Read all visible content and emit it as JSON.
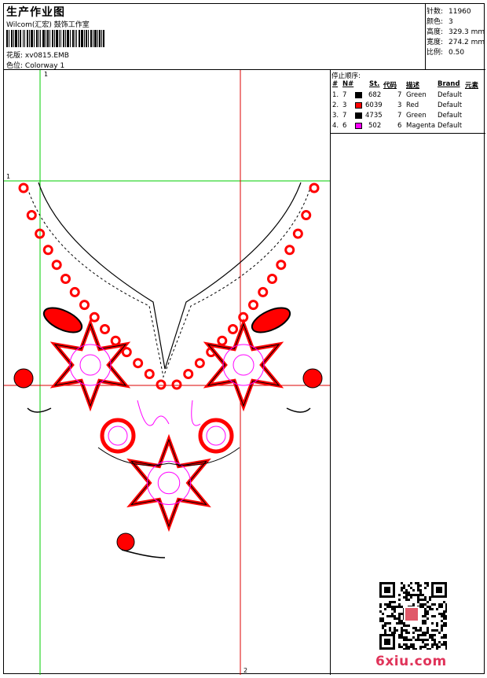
{
  "header": {
    "title": "生产作业图",
    "company": "Wilcom(汇宏) 鼓饰工作室",
    "design_label": "花版:",
    "design_value": "xv0815.EMB",
    "colorway_label": "色位:",
    "colorway_value": "Colorway 1"
  },
  "info": {
    "stitches_label": "针数:",
    "stitches": "11960",
    "colors_label": "颜色:",
    "colors": "3",
    "height_label": "高度:",
    "height": "329.3 mm",
    "width_label": "宽度:",
    "width": "274.2 mm",
    "scale_label": "比例:",
    "scale": "0.50"
  },
  "stop_sequence": {
    "title": "停止顺序:",
    "headers": [
      "#",
      "N#",
      "St.",
      "代码",
      "描述",
      "Brand",
      "元素"
    ],
    "rows": [
      {
        "idx": "1.",
        "n": "7",
        "color": "#000000",
        "st": "682",
        "code": "7",
        "desc": "Green",
        "brand": "Default"
      },
      {
        "idx": "2.",
        "n": "3",
        "color": "#ff0000",
        "st": "6039",
        "code": "3",
        "desc": "Red",
        "brand": "Default"
      },
      {
        "idx": "3.",
        "n": "7",
        "color": "#000000",
        "st": "4735",
        "code": "7",
        "desc": "Green",
        "brand": "Default"
      },
      {
        "idx": "4.",
        "n": "6",
        "color": "#ff00ff",
        "st": "502",
        "code": "6",
        "desc": "Magenta",
        "brand": "Default"
      }
    ]
  },
  "guides": {
    "green_vertical": "1",
    "green_horizontal": "1",
    "red_vertical": "2"
  },
  "colors": {
    "red": "#ff0000",
    "black": "#000000",
    "magenta": "#ff00ff",
    "green_guide": "#00cc00",
    "red_guide": "#dd0000"
  },
  "watermark": "6xiu.com"
}
